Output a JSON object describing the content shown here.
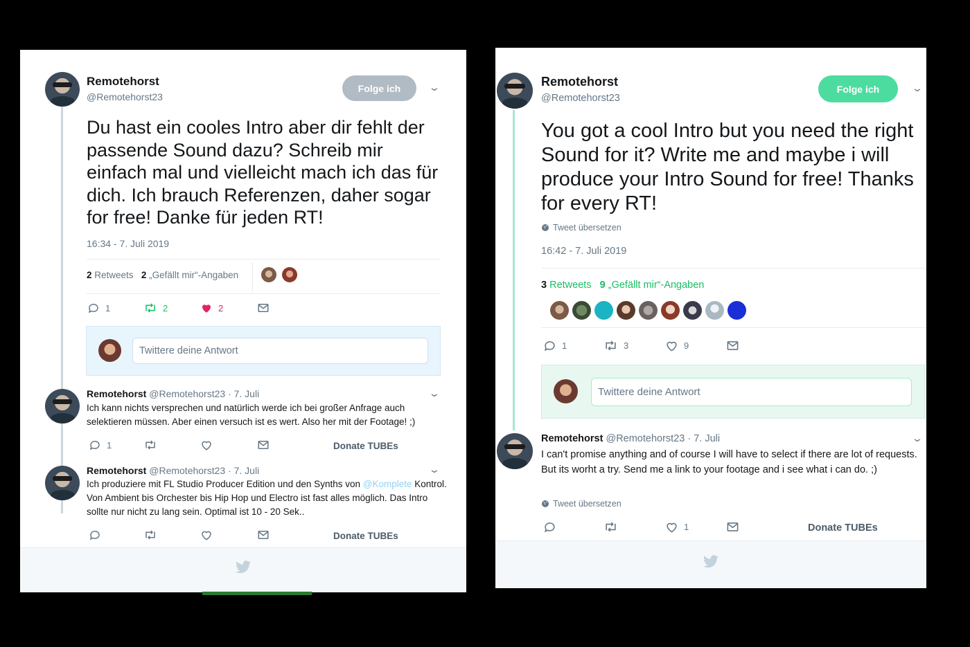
{
  "left": {
    "author": {
      "name": "Remotehorst",
      "handle": "@Remotehorst23"
    },
    "follow_label": "Folge ich",
    "follow_color": "#b1bbc4",
    "text": "Du hast ein cooles Intro aber dir fehlt der passende Sound dazu? Schreib mir einfach mal und vielleicht mach ich das für dich. Ich brauch Referenzen, daher sogar for free! Danke für jeden RT!",
    "timestamp": "16:34 - 7. Juli 2019",
    "stats": {
      "retweets_count": "2",
      "retweets_label": "Retweets",
      "likes_count": "2",
      "likes_label": "„Gefällt mir“-Angaben"
    },
    "actions": {
      "reply": "1",
      "retweet": "2",
      "like": "2"
    },
    "reply_placeholder": "Twittere deine Antwort",
    "replies": [
      {
        "name": "Remotehorst",
        "handle_date": "@Remotehorst23 · 7. Juli",
        "text": "Ich kann nichts versprechen und natürlich werde ich bei großer Anfrage auch selektieren müssen. Aber einen versuch ist es wert. Also her mit der Footage! ;)",
        "reply_count": "1",
        "donate": "Donate TUBEs"
      },
      {
        "name": "Remotehorst",
        "handle_date": "@Remotehorst23 · 7. Juli",
        "text_a": "Ich produziere mit FL Studio Producer Edition und den Synths von ",
        "mention": "@Komplete",
        "text_b": " Kontrol. Von Ambient bis Orchester bis Hip Hop und Electro ist fast alles möglich. Das Intro sollte nur nicht zu lang sein. Optimal ist 10 - 20 Sek..",
        "donate": "Donate TUBEs"
      }
    ]
  },
  "right": {
    "author": {
      "name": "Remotehorst",
      "handle": "@Remotehorst23"
    },
    "follow_label": "Folge ich",
    "follow_color": "#4ddca0",
    "text": "You got a cool Intro but you need the right Sound for it? Write me and maybe i will produce your Intro Sound for free! Thanks for every RT!",
    "translate": "Tweet übersetzen",
    "timestamp": "16:42 - 7. Juli 2019",
    "stats": {
      "retweets_count": "3",
      "retweets_label": "Retweets",
      "likes_count": "9",
      "likes_label": "„Gefällt mir“-Angaben"
    },
    "actions": {
      "reply": "1",
      "retweet": "3",
      "like": "9"
    },
    "reply_placeholder": "Twittere deine Antwort",
    "replies": [
      {
        "name": "Remotehorst",
        "handle_date": "@Remotehorst23 · 7. Juli",
        "text": "I can't promise anything and of course I will have to select if there are lot of requests. But its worht a try. Send me a link to your footage and i see what i can do. ;)",
        "translate": "Tweet übersetzen",
        "like_count": "1",
        "donate": "Donate TUBEs"
      }
    ]
  },
  "colors": {
    "accent_green": "#17bf63",
    "like_red": "#e0245e",
    "muted": "#657786"
  }
}
